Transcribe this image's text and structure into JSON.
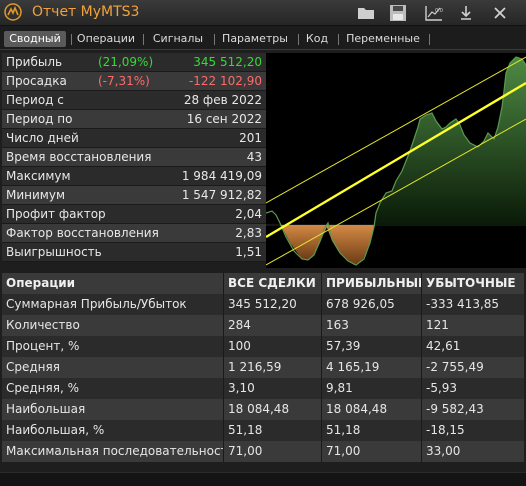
{
  "window": {
    "title": "Отчет MyMTS3",
    "icons": [
      "app-logo-icon",
      "folder-icon",
      "save-icon",
      "chart-export-icon",
      "download-icon",
      "close-icon"
    ]
  },
  "tabs": [
    {
      "label": "Сводный",
      "active": true
    },
    {
      "label": "Операции",
      "active": false
    },
    {
      "label": "Сигналы",
      "active": false
    },
    {
      "label": "Параметры",
      "active": false
    },
    {
      "label": "Код",
      "active": false
    },
    {
      "label": "Переменные",
      "active": false
    }
  ],
  "stats": [
    {
      "label": "Прибыль",
      "pct": "(21,09%)",
      "value": "345 512,20",
      "tone": "green"
    },
    {
      "label": "Просадка",
      "pct": "(-7,31%)",
      "value": "-122 102,90",
      "tone": "red"
    },
    {
      "label": "Период с",
      "pct": "",
      "value": "28 фев 2022",
      "tone": ""
    },
    {
      "label": "Период по",
      "pct": "",
      "value": "16 сен 2022",
      "tone": ""
    },
    {
      "label": "Число дней",
      "pct": "",
      "value": "201",
      "tone": ""
    },
    {
      "label": "Время восстановления",
      "pct": "",
      "value": "43",
      "tone": ""
    },
    {
      "label": "Максимум",
      "pct": "",
      "value": "1 984 419,09",
      "tone": ""
    },
    {
      "label": "Минимум",
      "pct": "",
      "value": "1 547 912,82",
      "tone": ""
    },
    {
      "label": "Профит фактор",
      "pct": "",
      "value": "2,04",
      "tone": ""
    },
    {
      "label": "Фактор восстановления",
      "pct": "",
      "value": "2,83",
      "tone": ""
    },
    {
      "label": "Выигрышность",
      "pct": "",
      "value": "1,51",
      "tone": ""
    }
  ],
  "colors": {
    "title": "#f2a23a",
    "profit": "#39d839",
    "loss": "#ff6a6a",
    "equity_fill": "#3f6e37",
    "drawdown_fill": "#c0773a",
    "trend_line": "#ffff2a"
  },
  "table": {
    "headers": [
      "Операции",
      "ВСЕ СДЕЛКИ",
      "ПРИБЫЛЬНЫЕ",
      "УБЫТОЧНЫЕ"
    ],
    "rows": [
      [
        "Суммарная Прибыль/Убыток",
        "345 512,20",
        "678 926,05",
        "-333 413,85"
      ],
      [
        "Количество",
        "284",
        "163",
        "121"
      ],
      [
        "Процент, %",
        "100",
        "57,39",
        "42,61"
      ],
      [
        "Средняя",
        "1 216,59",
        "4 165,19",
        "-2 755,49"
      ],
      [
        "Средняя, %",
        "3,10",
        "9,81",
        "-5,93"
      ],
      [
        "Наибольшая",
        "18 084,48",
        "18 084,48",
        "-9 582,43"
      ],
      [
        "Наибольшая, %",
        "51,18",
        "51,18",
        "-18,15"
      ],
      [
        "Максимальная последовательность",
        "71,00",
        "71,00",
        "33,00"
      ]
    ]
  }
}
